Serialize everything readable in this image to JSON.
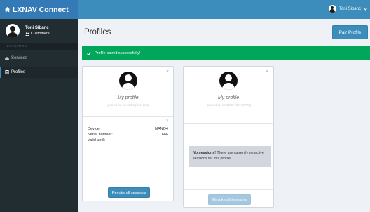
{
  "app": {
    "brand": "LXNAV Connect",
    "brand_icon": "home-icon"
  },
  "user": {
    "name": "Toni Šibanc",
    "role": "Customers",
    "top_name": "Toni Šibanc"
  },
  "sidebar": {
    "header": "NAVIGATION",
    "items": [
      {
        "label": "Services",
        "icon": "cloud-icon",
        "active": false
      },
      {
        "label": "Profiles",
        "icon": "id-card-icon",
        "active": true
      }
    ]
  },
  "page": {
    "title": "Profiles",
    "pair_button": "Pair Profile"
  },
  "alert": {
    "text": "Profile paired successfully!"
  },
  "profiles": [
    {
      "name": "My profile",
      "paired": "paired on NANO4 (SN: 666)",
      "device_label": "Device:",
      "device_value": "NANO4",
      "serial_label": "Serial number:",
      "serial_value": "666",
      "valid_label": "Valid until:",
      "revoke_label": "Revoke all sessions"
    },
    {
      "name": "My profile",
      "paired": "paired on LX9000 (SN: 8700)",
      "no_sessions_bold": "No sessions!",
      "no_sessions_text": " There are currently no active sessions for this profile.",
      "revoke_label": "Revoke all sessions"
    }
  ],
  "colors": {
    "topbar": "#3c8dbc",
    "sidebar": "#222d32",
    "success": "#00a65a",
    "primary": "#3c8dbc"
  }
}
